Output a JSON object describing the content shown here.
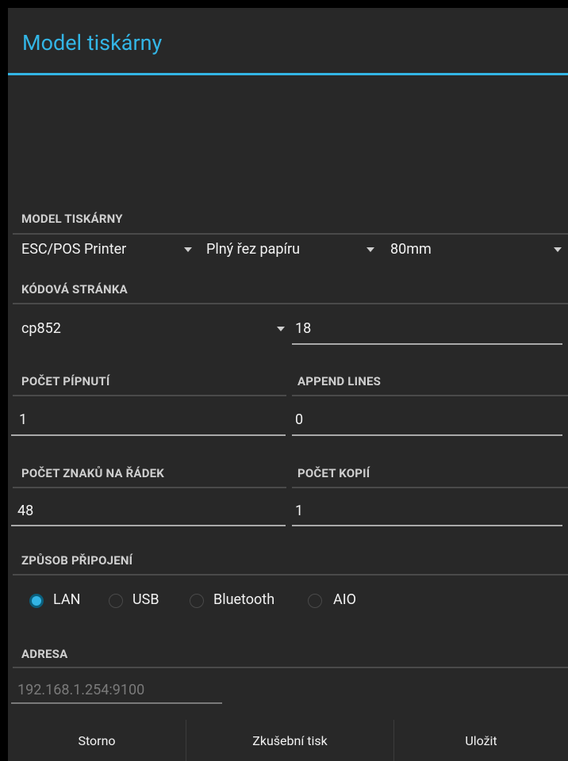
{
  "dialog": {
    "title": "Model tiskárny"
  },
  "printer_model": {
    "label": "MODEL TISKÁRNY",
    "model": "ESC/POS Printer",
    "cut_mode": "Plný řez papíru",
    "paper_width": "80mm"
  },
  "code_page": {
    "label": "KÓDOVÁ STRÁNKA",
    "value": "cp852",
    "number": "18"
  },
  "beeps": {
    "label": "POČET PÍPNUTÍ",
    "value": "1"
  },
  "append_lines": {
    "label": "APPEND LINES",
    "value": "0"
  },
  "chars_per_line": {
    "label": "POČET ZNAKŮ NA ŘÁDEK",
    "value": "48"
  },
  "copies": {
    "label": "POČET KOPIÍ",
    "value": "1"
  },
  "connection": {
    "label": "ZPŮSOB PŘIPOJENÍ",
    "options": [
      "LAN",
      "USB",
      "Bluetooth",
      "AIO"
    ],
    "selected": "LAN"
  },
  "address": {
    "label": "ADRESA",
    "placeholder": "192.168.1.254:9100"
  },
  "buttons": {
    "cancel": "Storno",
    "test_print": "Zkušební tisk",
    "save": "Uložit"
  },
  "colors": {
    "accent": "#33b5e5",
    "background": "#282828",
    "text": "#f2f2f2"
  }
}
